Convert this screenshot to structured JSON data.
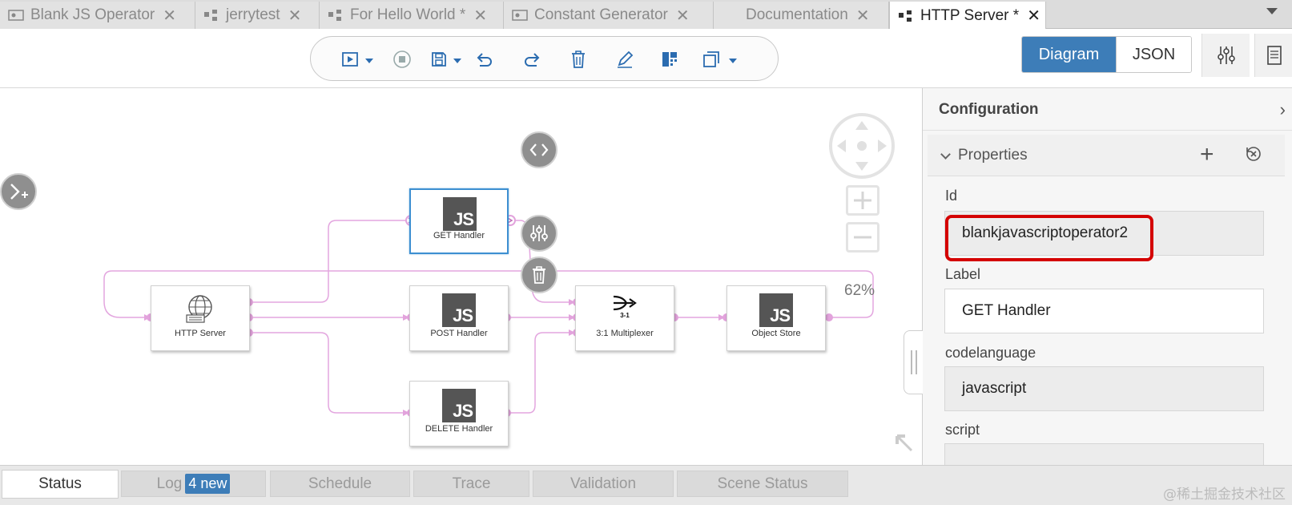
{
  "tabs": [
    {
      "label": "Blank JS Operator",
      "icon": "operator-icon"
    },
    {
      "label": "jerrytest",
      "icon": "graph-icon"
    },
    {
      "label": "For Hello World *",
      "icon": "graph-icon"
    },
    {
      "label": "Constant Generator",
      "icon": "operator-icon"
    },
    {
      "label": "Documentation",
      "icon": ""
    },
    {
      "label": "HTTP Server *",
      "icon": "graph-icon",
      "active": true
    }
  ],
  "view_toggle": {
    "diagram": "Diagram",
    "json": "JSON",
    "selected": "Diagram"
  },
  "nodes": {
    "http_server": "HTTP Server",
    "get_handler": "GET Handler",
    "post_handler": "POST Handler",
    "delete_handler": "DELETE Handler",
    "multiplexer": "3:1 Multiplexer",
    "multiplexer_badge": "3-1",
    "object_store": "Object Store",
    "js_glyph": "JS"
  },
  "zoom": "62%",
  "config": {
    "title": "Configuration",
    "section": "Properties",
    "fields": [
      {
        "label": "Id",
        "value": "blankjavascriptoperator2",
        "readonly": true
      },
      {
        "label": "Label",
        "value": "GET Handler",
        "readonly": false
      },
      {
        "label": "codelanguage",
        "value": "javascript",
        "readonly": true
      },
      {
        "label": "script",
        "value": "",
        "readonly": true
      }
    ]
  },
  "bottom_tabs": [
    {
      "label": "Status",
      "active": true
    },
    {
      "label": "Log",
      "badge": "4 new"
    },
    {
      "label": "Schedule"
    },
    {
      "label": "Trace"
    },
    {
      "label": "Validation"
    },
    {
      "label": "Scene Status"
    }
  ],
  "watermark": "@稀土掘金技术社区",
  "colors": {
    "accent": "#3d7db8",
    "selection": "#3d8fd1",
    "edge": "#e3a6df",
    "highlight": "#d40000"
  }
}
